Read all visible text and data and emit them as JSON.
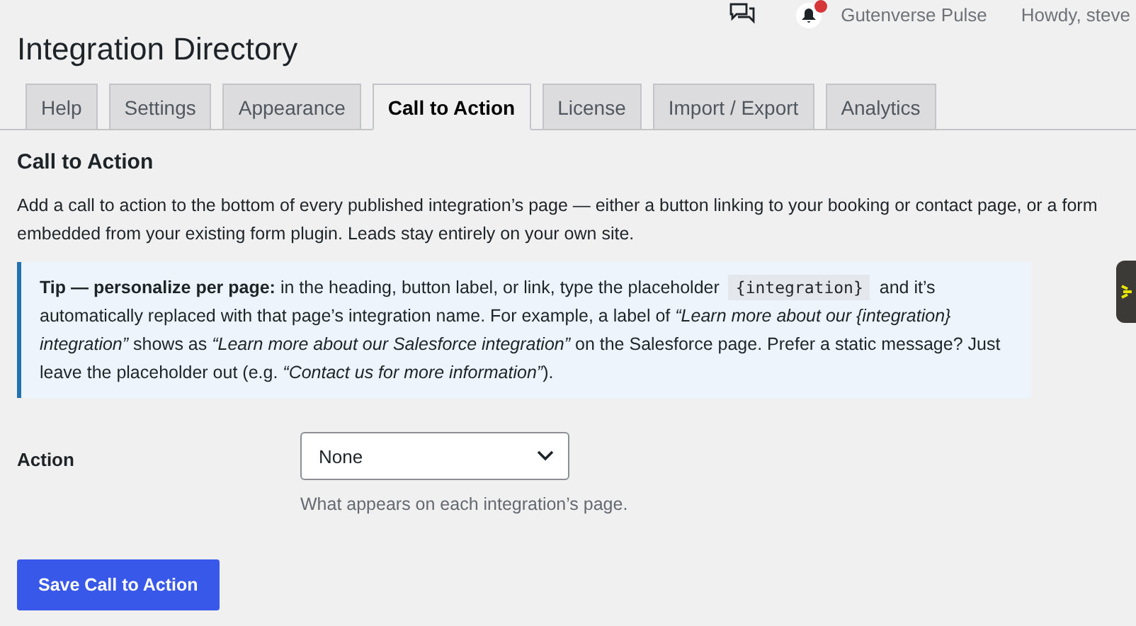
{
  "admin_bar": {
    "site_name": "Gutenverse Pulse",
    "greeting": "Howdy, steve",
    "notification": true
  },
  "title": "Integration Directory",
  "tabs": [
    {
      "label": "Help",
      "selected": false
    },
    {
      "label": "Settings",
      "selected": false
    },
    {
      "label": "Appearance",
      "selected": false
    },
    {
      "label": "Call to Action",
      "selected": true
    },
    {
      "label": "License",
      "selected": false
    },
    {
      "label": "Import / Export",
      "selected": false
    },
    {
      "label": "Analytics",
      "selected": false
    }
  ],
  "section_heading": "Call to Action",
  "description": "Add a call to action to the bottom of every published integration’s page — either a button linking to your booking or contact page, or a form embedded from your existing form plugin. Leads stay entirely on your own site.",
  "tip": {
    "before": "**Tip — personalize per page:** in the heading, button label, or link, type the placeholder",
    "code": "{integration}",
    "after": "and it’s automatically replaced with that page’s integration name. For example, a label of *“Learn more about our {integration} integration”* shows as *“Learn more about our Salesforce integration”* on the Salesforce page. Prefer a static message? Just leave the placeholder out (e.g. *“Contact us for more information”*)."
  },
  "fields": [
    {
      "label": "Action",
      "value": "None",
      "help": "What appears on each integration’s page."
    }
  ],
  "save_button": "Save Call to Action"
}
